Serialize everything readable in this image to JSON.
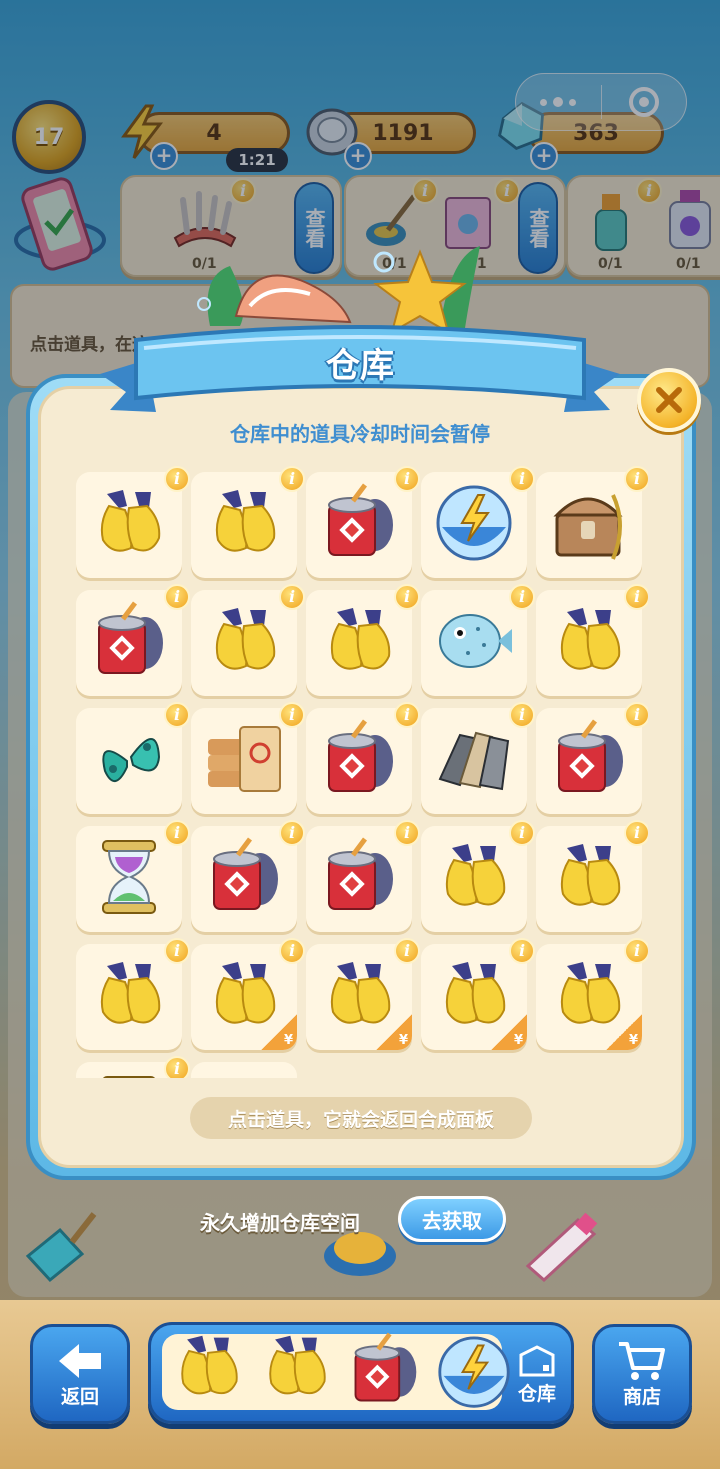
{
  "hud": {
    "level": "17",
    "energy": "4",
    "energy_timer": "1:21",
    "coins": "1191",
    "gems": "363"
  },
  "orders": {
    "look_label": "查看",
    "counts": [
      "0/1",
      "0/1",
      "0/1",
      "0/1",
      "0/1"
    ]
  },
  "hint_bar": {
    "text": "点击道具，在这"
  },
  "warehouse": {
    "title": "仓库",
    "subtitle": "仓库中的道具冷却时间会暂停",
    "footer_tip": "点击道具，它就会返回合成面板",
    "info_glyph": "i",
    "yen_glyph": "¥",
    "items": [
      {
        "icon": "gloves"
      },
      {
        "icon": "gloves"
      },
      {
        "icon": "paint-bucket"
      },
      {
        "icon": "energy-bowl"
      },
      {
        "icon": "treasure-chest"
      },
      {
        "icon": "paint-bucket"
      },
      {
        "icon": "gloves"
      },
      {
        "icon": "gloves"
      },
      {
        "icon": "pufferfish"
      },
      {
        "icon": "gloves"
      },
      {
        "icon": "butterfly-wings"
      },
      {
        "icon": "cement-bags"
      },
      {
        "icon": "paint-bucket"
      },
      {
        "icon": "tiles"
      },
      {
        "icon": "paint-bucket"
      },
      {
        "icon": "hourglass"
      },
      {
        "icon": "paint-bucket"
      },
      {
        "icon": "paint-bucket"
      },
      {
        "icon": "gloves"
      },
      {
        "icon": "gloves"
      },
      {
        "icon": "gloves"
      },
      {
        "icon": "gloves",
        "paid": true
      },
      {
        "icon": "gloves",
        "paid": true
      },
      {
        "icon": "gloves",
        "paid": true
      },
      {
        "icon": "gloves",
        "paid": true
      },
      {
        "icon": "hourglass"
      },
      {
        "icon": "empty"
      }
    ]
  },
  "expand": {
    "text": "永久增加仓库空间",
    "button": "去获取"
  },
  "bottom_nav": {
    "back": "返回",
    "warehouse": "仓库",
    "shop": "商店",
    "tray_items": [
      "gloves",
      "gloves",
      "paint-bucket",
      "energy-bowl"
    ]
  },
  "colors": {
    "accent_blue": "#3f8ed0",
    "panel_cream": "#f6ebd2",
    "gold": "#f0a21c"
  }
}
